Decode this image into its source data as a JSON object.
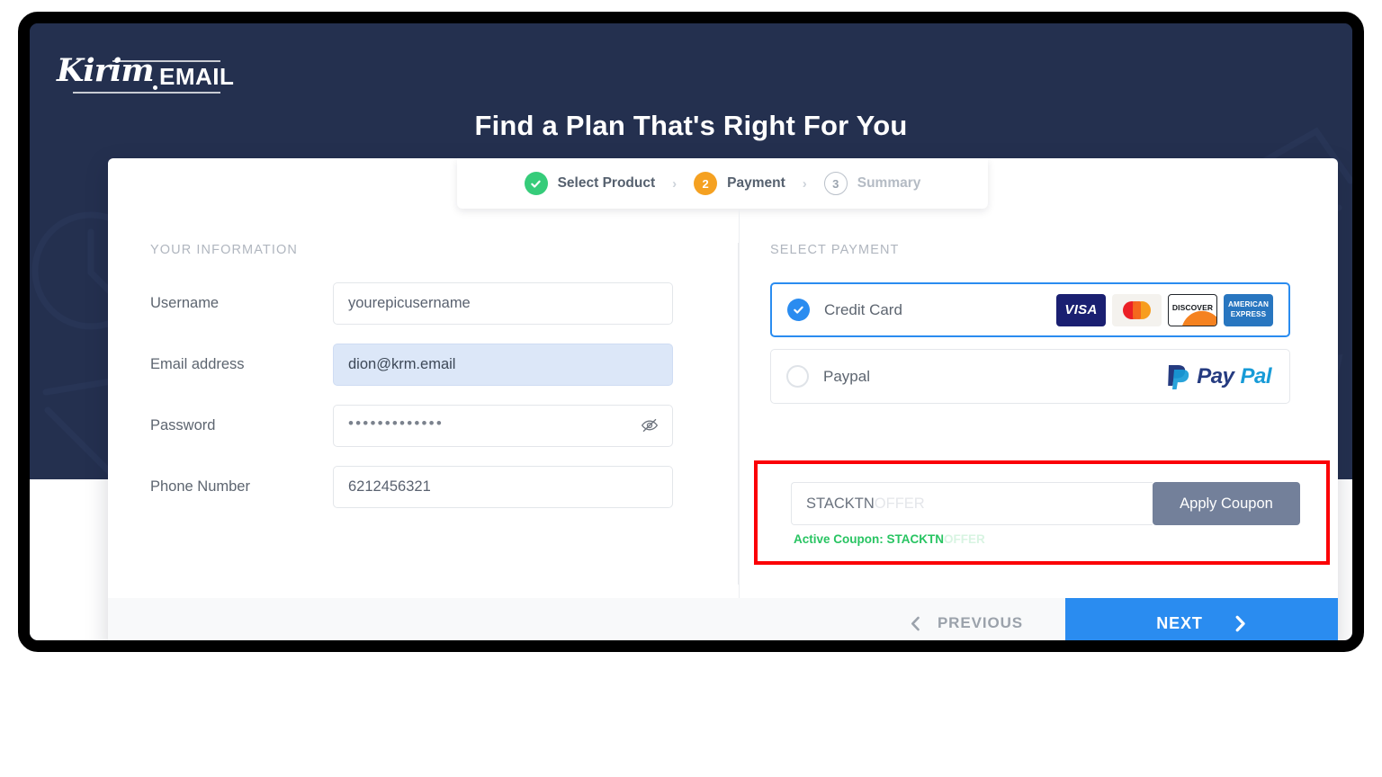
{
  "brand": {
    "logo_script": "Kirim",
    "logo_mail": "EMAIL"
  },
  "headline": "Find a Plan That's Right For You",
  "stepper": {
    "separator": "›",
    "steps": [
      {
        "badge": "✓",
        "label": "Select Product",
        "state": "done"
      },
      {
        "badge": "2",
        "label": "Payment",
        "state": "active"
      },
      {
        "badge": "3",
        "label": "Summary",
        "state": "todo"
      }
    ]
  },
  "left_panel": {
    "section_title": "YOUR INFORMATION",
    "fields": [
      {
        "label": "Username",
        "value": "yourepicusername",
        "type": "text"
      },
      {
        "label": "Email address",
        "value": "dion@krm.email",
        "type": "autofill"
      },
      {
        "label": "Password",
        "value": "•••••••••••••",
        "type": "password"
      },
      {
        "label": "Phone Number",
        "value": "6212456321",
        "type": "text"
      }
    ]
  },
  "right_panel": {
    "section_title": "SELECT PAYMENT",
    "options": [
      {
        "label": "Credit Card",
        "selected": true,
        "brands": [
          "VISA",
          "Mastercard",
          "DISCOVER",
          "AMERICAN EXPRESS"
        ]
      },
      {
        "label": "Paypal",
        "selected": false,
        "brands": [
          "PayPal"
        ]
      }
    ],
    "brand_text": {
      "visa": "VISA",
      "discover": "DISCOVER",
      "amex_line1": "AMERICAN",
      "amex_line2": "EXPRESS",
      "paypal_dark": "Pay",
      "paypal_light": "Pal"
    },
    "coupon": {
      "input_value": "STACKTN",
      "input_value_faded": "OFFER",
      "apply_label": "Apply Coupon",
      "active_prefix": "Active Coupon: STACKTN",
      "active_faded": "OFFER",
      "highlight_color": "#fb0006",
      "active_color": "#28c462"
    }
  },
  "footer": {
    "previous_label": "PREVIOUS",
    "next_label": "NEXT"
  },
  "colors": {
    "page_background": "#24304f",
    "accent_blue": "#2a8cf0",
    "step_done": "#36cc7a",
    "step_active": "#f5a121",
    "apply_button": "#73809a"
  }
}
